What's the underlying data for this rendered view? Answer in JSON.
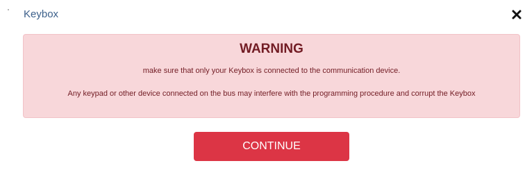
{
  "dialog": {
    "title": "Keybox",
    "close_icon": "close-icon"
  },
  "warning": {
    "heading": "WARNING",
    "line1": "make sure that only your Keybox is connected to the communication device.",
    "line2": "Any keypad or other device connected on the bus may interfere with the programming procedure and corrupt the Keybox",
    "background_color": "#f8d7da",
    "text_color": "#721c24"
  },
  "actions": {
    "continue_label": "CONTINUE",
    "continue_color": "#dc3545"
  }
}
